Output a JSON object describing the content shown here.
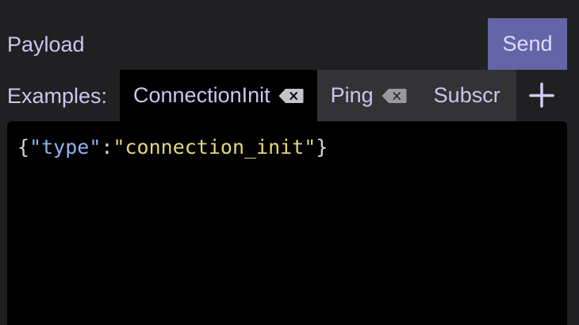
{
  "payload": {
    "label": "Payload",
    "send_label": "Send"
  },
  "examples": {
    "label": "Examples:",
    "tabs": [
      {
        "label": "ConnectionInit",
        "active": true
      },
      {
        "label": "Ping",
        "active": false
      },
      {
        "label": "Subscr",
        "active": false
      }
    ],
    "add_icon": "plus-icon",
    "close_icon": "backspace-x-icon"
  },
  "editor": {
    "open_brace": "{",
    "key": "\"type\"",
    "colon": ":",
    "value": "\"connection_init\"",
    "close_brace": "}"
  },
  "colors": {
    "background": "#202022",
    "accent": "#6464a8",
    "editor_bg": "#000000",
    "text": "#c9c6f0",
    "json_key": "#8cb4f4",
    "json_string": "#e4d87a"
  }
}
